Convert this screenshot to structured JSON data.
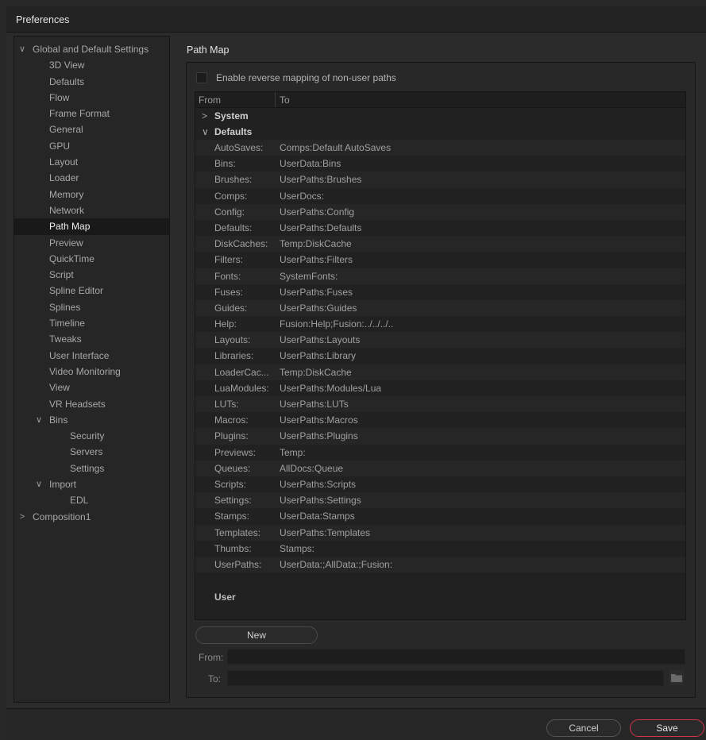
{
  "window": {
    "title": "Preferences"
  },
  "tree": [
    {
      "label": "Global and Default Settings",
      "level": 0,
      "arrow": "expanded"
    },
    {
      "label": "3D View",
      "level": 1
    },
    {
      "label": "Defaults",
      "level": 1
    },
    {
      "label": "Flow",
      "level": 1
    },
    {
      "label": "Frame Format",
      "level": 1
    },
    {
      "label": "General",
      "level": 1
    },
    {
      "label": "GPU",
      "level": 1
    },
    {
      "label": "Layout",
      "level": 1
    },
    {
      "label": "Loader",
      "level": 1
    },
    {
      "label": "Memory",
      "level": 1
    },
    {
      "label": "Network",
      "level": 1
    },
    {
      "label": "Path Map",
      "level": 1,
      "selected": true
    },
    {
      "label": "Preview",
      "level": 1
    },
    {
      "label": "QuickTime",
      "level": 1
    },
    {
      "label": "Script",
      "level": 1
    },
    {
      "label": "Spline Editor",
      "level": 1
    },
    {
      "label": "Splines",
      "level": 1
    },
    {
      "label": "Timeline",
      "level": 1
    },
    {
      "label": "Tweaks",
      "level": 1
    },
    {
      "label": "User Interface",
      "level": 1
    },
    {
      "label": "Video Monitoring",
      "level": 1
    },
    {
      "label": "View",
      "level": 1
    },
    {
      "label": "VR Headsets",
      "level": 1
    },
    {
      "label": "Bins",
      "level": 1,
      "arrow": "expanded"
    },
    {
      "label": "Security",
      "level": 2
    },
    {
      "label": "Servers",
      "level": 2
    },
    {
      "label": "Settings",
      "level": 2
    },
    {
      "label": "Import",
      "level": 1,
      "arrow": "expanded"
    },
    {
      "label": "EDL",
      "level": 2
    },
    {
      "label": "Composition1",
      "level": 0,
      "arrow": "collapsed"
    }
  ],
  "pathmap": {
    "section_title": "Path Map",
    "reverse_mapping_label": "Enable reverse mapping of non-user paths",
    "reverse_mapping_checked": false,
    "columns": {
      "from": "From",
      "to": "To"
    },
    "system_group": "System",
    "defaults_group": "Defaults",
    "user_group": "User",
    "rows": [
      {
        "from": "AutoSaves:",
        "to": "Comps:Default AutoSaves"
      },
      {
        "from": "Bins:",
        "to": "UserData:Bins"
      },
      {
        "from": "Brushes:",
        "to": "UserPaths:Brushes"
      },
      {
        "from": "Comps:",
        "to": "UserDocs:"
      },
      {
        "from": "Config:",
        "to": "UserPaths:Config"
      },
      {
        "from": "Defaults:",
        "to": "UserPaths:Defaults"
      },
      {
        "from": "DiskCaches:",
        "to": "Temp:DiskCache"
      },
      {
        "from": "Filters:",
        "to": "UserPaths:Filters"
      },
      {
        "from": "Fonts:",
        "to": "SystemFonts:"
      },
      {
        "from": "Fuses:",
        "to": "UserPaths:Fuses"
      },
      {
        "from": "Guides:",
        "to": "UserPaths:Guides"
      },
      {
        "from": "Help:",
        "to": "Fusion:Help;Fusion:../../../.."
      },
      {
        "from": "Layouts:",
        "to": "UserPaths:Layouts"
      },
      {
        "from": "Libraries:",
        "to": "UserPaths:Library"
      },
      {
        "from": "LoaderCac...",
        "to": "Temp:DiskCache"
      },
      {
        "from": "LuaModules:",
        "to": "UserPaths:Modules/Lua"
      },
      {
        "from": "LUTs:",
        "to": "UserPaths:LUTs"
      },
      {
        "from": "Macros:",
        "to": "UserPaths:Macros"
      },
      {
        "from": "Plugins:",
        "to": "UserPaths:Plugins"
      },
      {
        "from": "Previews:",
        "to": "Temp:"
      },
      {
        "from": "Queues:",
        "to": "AllDocs:Queue"
      },
      {
        "from": "Scripts:",
        "to": "UserPaths:Scripts"
      },
      {
        "from": "Settings:",
        "to": "UserPaths:Settings"
      },
      {
        "from": "Stamps:",
        "to": "UserData:Stamps"
      },
      {
        "from": "Templates:",
        "to": "UserPaths:Templates"
      },
      {
        "from": "Thumbs:",
        "to": "Stamps:"
      },
      {
        "from": "UserPaths:",
        "to": "UserData:;AllData:;Fusion:"
      }
    ],
    "new_button": "New",
    "from_label": "From:",
    "to_label": "To:",
    "from_value": "",
    "to_value": ""
  },
  "footer": {
    "cancel": "Cancel",
    "save": "Save",
    "save_accent": "#d6324a"
  }
}
